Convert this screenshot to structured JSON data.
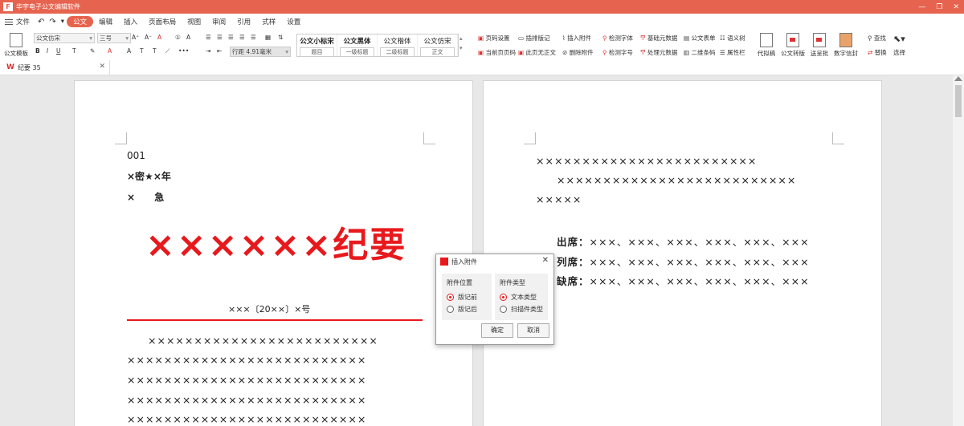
{
  "app": {
    "title": "华宇电子公文编辑软件"
  },
  "window_controls": {
    "minimize": "—",
    "restore": "❐",
    "close": "✕"
  },
  "menu": {
    "file": "文件",
    "items": [
      "公文",
      "编辑",
      "插入",
      "页面布局",
      "视图",
      "审阅",
      "引用",
      "式样",
      "设置"
    ]
  },
  "ribbon": {
    "template_btn": "公文模板",
    "font_name": "公文仿宋",
    "font_size": "三号",
    "line_spacing": "行距 4.91毫米",
    "styles": [
      {
        "name": "公文小标宋",
        "tag": "题目"
      },
      {
        "name": "公文黑体",
        "tag": "一级标题"
      },
      {
        "name": "公文楷体",
        "tag": "二级标题"
      },
      {
        "name": "公文仿宋",
        "tag": "正文"
      }
    ],
    "cmds_col1": [
      "页码设置",
      "当前页页码"
    ],
    "cmds_col2": [
      "插排版记",
      "此页无正文"
    ],
    "cmds_col3": [
      "插入附件",
      "删除附件"
    ],
    "cmds_col4": [
      "检测字体",
      "检测字号"
    ],
    "cmds_col5": [
      "基础元数据",
      "处理元数据"
    ],
    "cmds_col6": [
      "公文表单",
      "二维条码"
    ],
    "cmds_col7": [
      "语义树",
      "属性栏"
    ],
    "big_btns": [
      "代拟稿",
      "公文转版",
      "送呈批",
      "数字信封"
    ],
    "find": "查找",
    "replace": "替换",
    "select": "选择"
  },
  "tab": {
    "name": "纪要 35"
  },
  "page1": {
    "doc_no": "001",
    "secret": "×密★×年",
    "urgent": "× 急",
    "title": "××××××纪要",
    "ref_no": "×××〔20××〕×号",
    "body": [
      "×××××××××××××××××××××××××",
      "××××××××××××××××××××××××××",
      "××××××××××××××××××××××××××",
      "××××××××××××××××××××××××××",
      "××××××××××××××××××××××××××"
    ]
  },
  "page2": {
    "body": [
      "××××××××××××××××××××××××",
      "××××××××××××××××××××××××××",
      "×××××"
    ],
    "attend_label": "出席：",
    "attend": "×××、×××、×××、×××、×××、×××",
    "listen_label": "列席：",
    "listen": "×××、×××、×××、×××、×××、×××",
    "absent_label": "缺席：",
    "absent": "×××、×××、×××、×××、×××、×××"
  },
  "dialog": {
    "title": "插入附件",
    "position_group": "附件位置",
    "position_options": [
      "版记前",
      "版记后"
    ],
    "type_group": "附件类型",
    "type_options": [
      "文本类型",
      "扫描件类型"
    ],
    "ok": "确定",
    "cancel": "取消"
  }
}
